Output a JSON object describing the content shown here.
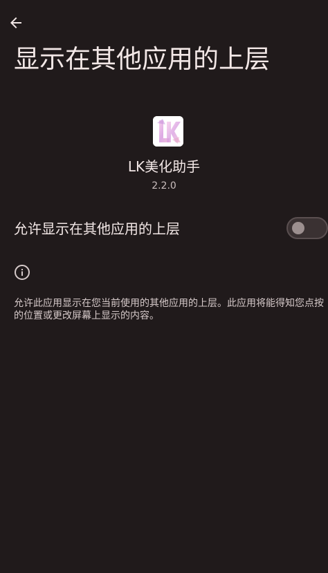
{
  "page": {
    "title": "显示在其他应用的上层"
  },
  "app": {
    "name": "LK美化助手",
    "version": "2.2.0",
    "icon_letters": "LK"
  },
  "toggle": {
    "label": "允许显示在其他应用的上层",
    "enabled": false
  },
  "info": {
    "description": "允许此应用显示在您当前使用的其他应用的上层。此应用将能得知您点按的位置或更改屏幕上显示的内容。"
  },
  "colors": {
    "background": "#201a1b",
    "text_primary": "#f2e7e6",
    "text_secondary": "#cbbfbf",
    "switch_off_track": "#3a3132",
    "switch_off_thumb": "#9c8f8f",
    "icon_accent": "#e8a4d8"
  },
  "icons": {
    "back": "arrow-left-icon",
    "info": "info-circle-icon"
  }
}
